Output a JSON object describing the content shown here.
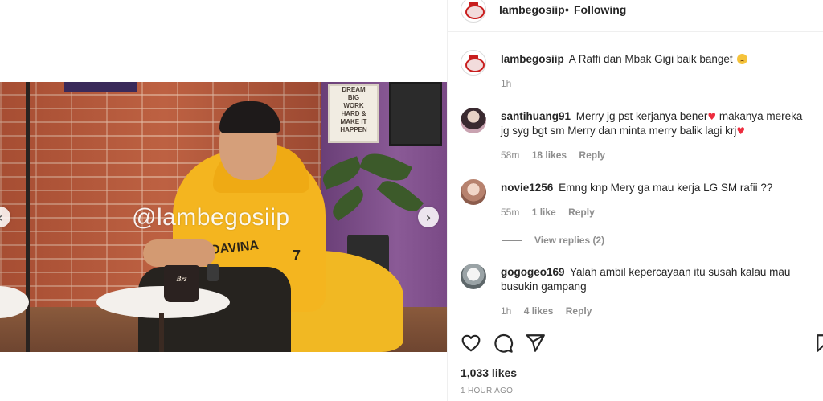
{
  "header": {
    "username": "lambegosiip",
    "separator": "•",
    "follow_status": "Following"
  },
  "video": {
    "watermark": "@lambegosiip",
    "mug_text": "Brz",
    "poster_lines": [
      "DREAM",
      "BIG",
      "WORK",
      "HARD &",
      "MAKE IT",
      "HAPPEN"
    ],
    "hoodie_text": "DAVINA",
    "hoodie_number": "7"
  },
  "caption": {
    "username": "lambegosiip",
    "text": "A Raffi dan Mbak Gigi baik banget",
    "time": "1h"
  },
  "comments": [
    {
      "username": "santihuang91",
      "text_part1": "Merry jg pst kerjanya bener",
      "text_part2": " makanya mereka jg syg bgt sm Merry dan minta merry balik lagi krj",
      "time": "58m",
      "likes": "18 likes",
      "reply": "Reply"
    },
    {
      "username": "novie1256",
      "text": "Emng knp Mery ga mau kerja LG SM rafii ??",
      "time": "55m",
      "likes": "1 like",
      "reply": "Reply",
      "view_replies": "View replies (2)"
    },
    {
      "username": "gogogeo169",
      "text": "Yalah ambil kepercayaan itu susah kalau mau busukin gampang",
      "time": "1h",
      "likes": "4 likes",
      "reply": "Reply"
    }
  ],
  "icons": {
    "heart_glyph": "♥",
    "prev": "‹",
    "next": "›"
  },
  "footer": {
    "likes": "1,033 likes",
    "time_ago": "1 HOUR AGO"
  }
}
